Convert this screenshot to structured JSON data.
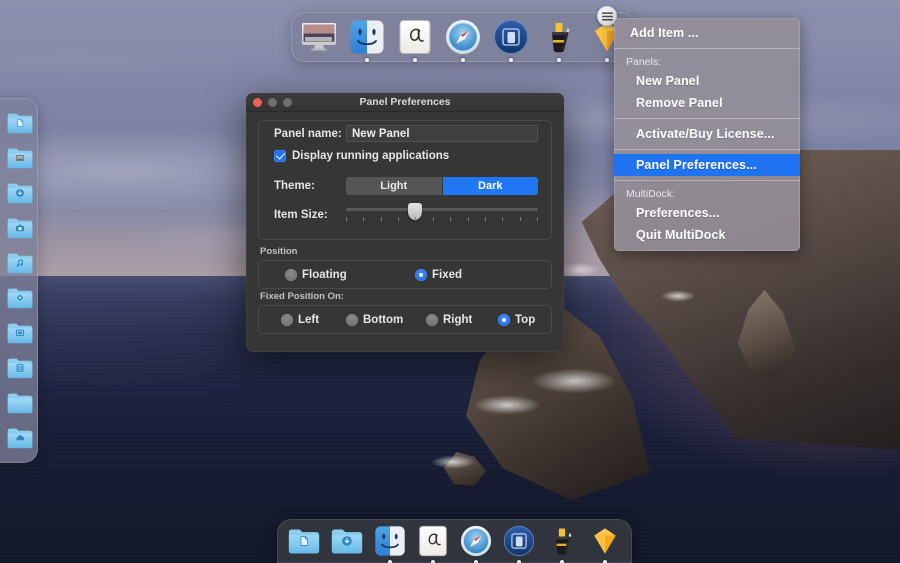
{
  "desktop": {
    "wallpaper_name": "catalina-coast-dusk"
  },
  "top_panel": {
    "name": "New Panel",
    "theme": "light",
    "position": "top",
    "items": [
      {
        "icon": "imac-display-icon",
        "label": "iMac",
        "running": false
      },
      {
        "icon": "finder-icon",
        "label": "Finder",
        "running": true
      },
      {
        "icon": "notes-script-a-icon",
        "label": "Notes",
        "running": true
      },
      {
        "icon": "safari-compass-icon",
        "label": "Safari",
        "running": true
      },
      {
        "icon": "simulator-icon",
        "label": "Simulator",
        "running": true
      },
      {
        "icon": "xcode-hammer-icon",
        "label": "Xcode",
        "running": true
      },
      {
        "icon": "sketch-diamond-icon",
        "label": "Sketch",
        "running": true
      }
    ],
    "menu_button": {
      "icon": "hamburger-menu-icon",
      "label": "Panel menu"
    }
  },
  "left_panel": {
    "items": [
      {
        "icon": "folder-document-icon",
        "label": "Documents"
      },
      {
        "icon": "folder-pictures-icon",
        "label": "Pictures"
      },
      {
        "icon": "folder-downloads-icon",
        "label": "Downloads"
      },
      {
        "icon": "folder-camera-icon",
        "label": "Camera"
      },
      {
        "icon": "folder-music-icon",
        "label": "Music"
      },
      {
        "icon": "folder-applications-icon",
        "label": "Applications"
      },
      {
        "icon": "folder-desktop-icon",
        "label": "Desktop"
      },
      {
        "icon": "folder-library-icon",
        "label": "Library"
      },
      {
        "icon": "folder-plain-icon",
        "label": "Folder"
      },
      {
        "icon": "folder-icloud-icon",
        "label": "iCloud Drive"
      }
    ]
  },
  "bottom_dock": {
    "items": [
      {
        "icon": "folder-document-icon",
        "label": "Documents",
        "running": false
      },
      {
        "icon": "folder-downloads-icon",
        "label": "Downloads",
        "running": false
      },
      {
        "icon": "finder-icon",
        "label": "Finder",
        "running": true
      },
      {
        "icon": "notes-script-a-icon",
        "label": "Notes",
        "running": true
      },
      {
        "icon": "safari-compass-icon",
        "label": "Safari",
        "running": true
      },
      {
        "icon": "simulator-icon",
        "label": "Simulator",
        "running": true
      },
      {
        "icon": "xcode-hammer-icon",
        "label": "Xcode",
        "running": true
      },
      {
        "icon": "sketch-diamond-icon",
        "label": "Sketch",
        "running": true
      }
    ]
  },
  "context_menu": {
    "add_item": "Add Item ...",
    "panels_caption": "Panels:",
    "new_panel": "New Panel",
    "remove_panel": "Remove Panel",
    "activate_license": "Activate/Buy License...",
    "panel_preferences": "Panel Preferences...",
    "multidock_caption": "MultiDock:",
    "preferences": "Preferences...",
    "quit": "Quit MultiDock",
    "selected_item": "Panel Preferences...",
    "highlight_color": "#1f72f0"
  },
  "prefs_window": {
    "title": "Panel Preferences",
    "traffic_lights": {
      "close": "close-button",
      "minimize": "minimize-button",
      "zoom": "zoom-button",
      "close_color": "#f0615a",
      "inactive_color": "#6e6e6e"
    },
    "panel_name_label": "Panel name:",
    "panel_name_value": "New Panel",
    "panel_name_placeholder": "Panel name",
    "display_running_label": "Display running applications",
    "display_running_checked": true,
    "theme_label": "Theme:",
    "theme_options": [
      "Light",
      "Dark"
    ],
    "theme_selected": "Dark",
    "theme_accent": "#2176f3",
    "item_size_label": "Item Size:",
    "item_size_value": 33,
    "item_size_ticks": 12,
    "position_caption": "Position",
    "position_options": [
      {
        "label": "Floating",
        "selected": false
      },
      {
        "label": "Fixed",
        "selected": true
      }
    ],
    "fixed_position_caption": "Fixed Position On:",
    "fixed_position_options": [
      {
        "label": "Left",
        "selected": false
      },
      {
        "label": "Bottom",
        "selected": false
      },
      {
        "label": "Right",
        "selected": false
      },
      {
        "label": "Top",
        "selected": true
      }
    ]
  }
}
